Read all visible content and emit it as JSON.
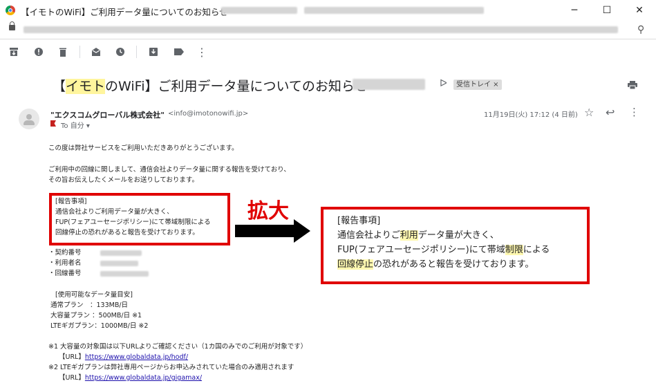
{
  "window": {
    "title": "【イモトのWiFi】ご利用データ量についてのお知らせ",
    "controls": {
      "minimize": "─",
      "maximize": "☐",
      "close": "✕"
    }
  },
  "toolbar": {
    "icons": [
      "archive-icon",
      "report-spam-icon",
      "delete-icon",
      "mark-unread-icon",
      "snooze-icon",
      "move-to-icon",
      "label-icon",
      "more-vert-icon"
    ]
  },
  "email": {
    "subject_prefix": "【",
    "subject_highlight": "イモト",
    "subject_rest": "のWiFi】ご利用データ量についてのお知らせ",
    "label_chip": "受信トレイ ×",
    "sender_name": "\"エクスコムグローバル株式会社\"",
    "sender_email": "<info@imotonowifi.jp>",
    "to_line": "To 自分 ▾",
    "date": "11月19日(火) 17:12 (4 日前)"
  },
  "body": {
    "greeting": "この度は弊社サービスをご利用いただきありがとうございます。",
    "intro1": "ご利用中の回線に関しまして、通信会社よりデータ量に関する報告を受けており、",
    "intro2": "その旨お伝えしたくメールをお送りしております。",
    "report_title": "[報告事項]",
    "report1": "通信会社よりご利用データ量が大きく、",
    "report2": "FUP(フェアユーセージポリシー)にて帯域制限による",
    "report3": "回線停止の恐れがあると報告を受けております。",
    "info_contract": "・契約番号",
    "info_user": "・利用者名",
    "info_line": "・回線番号",
    "plans_title": "[使用可能なデータ量目安]",
    "plan1": "通常プラン　：133MB/日",
    "plan2": "大容量プラン ：500MB/日 ※1",
    "plan3": "LTEギガプラン：1000MB/日 ※2",
    "note1": "※1 大容量の対象国は以下URLよりご確認ください（1カ国のみでのご利用が対象です）",
    "url_label": "【URL】",
    "url1": "https://www.globaldata.jp/hodf/",
    "note2": "※2 LTEギガプランは弊社専用ページからお申込みされていた場合のみ適用されます",
    "url2": "https://www.globaldata.jp/gigamax/"
  },
  "zoom": {
    "label": "拡大",
    "title": "[報告事項]",
    "line1_a": "通信会社よりご",
    "line1_hl": "利用",
    "line1_b": "データ量が大きく、",
    "line2_a": "FUP(フェアユーセージポリシー)にて帯域",
    "line2_hl": "制限",
    "line2_b": "による",
    "line3_hl": "回線停止",
    "line3_b": "の恐れがあると報告を受けております。"
  }
}
